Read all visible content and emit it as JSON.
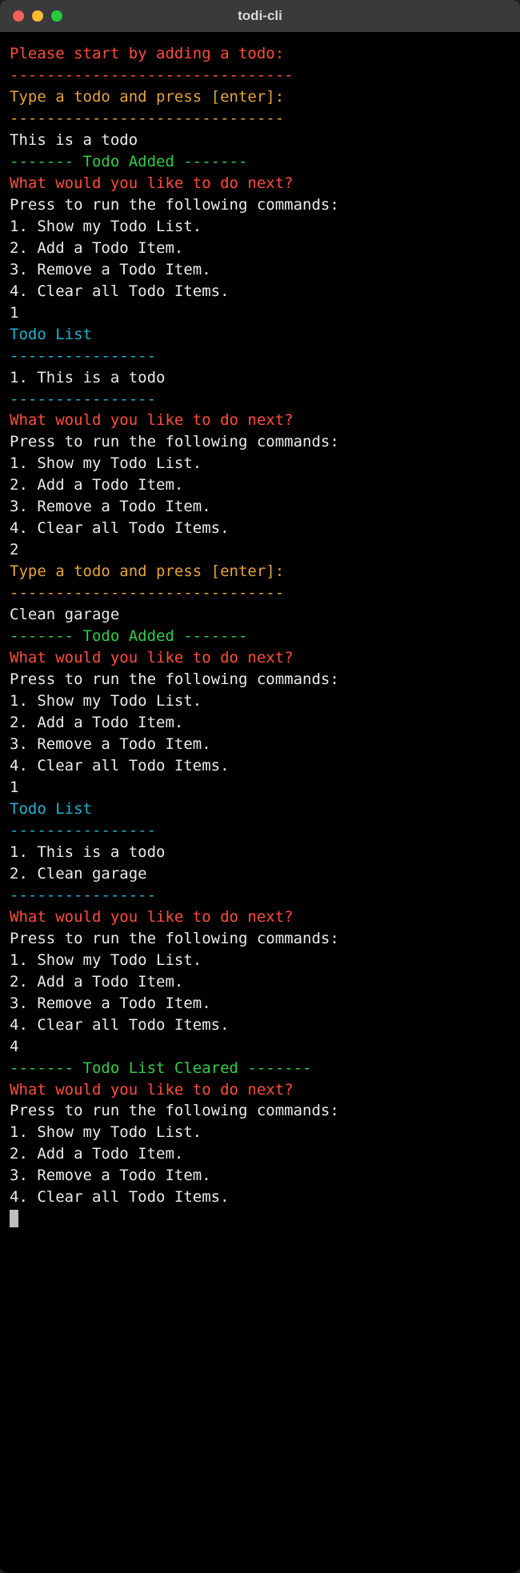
{
  "window": {
    "title": "todi-cli"
  },
  "colors": {
    "red": "#ff4c3d",
    "orange": "#e5a33b",
    "green": "#2fcc4a",
    "cyan": "#1fb3d4",
    "white": "#eaeaea"
  },
  "lines": [
    {
      "color": "red",
      "text": "Please start by adding a todo:"
    },
    {
      "color": "red",
      "text": "-------------------------------"
    },
    {
      "color": "orange",
      "text": "Type a todo and press [enter]:"
    },
    {
      "color": "orange",
      "text": "------------------------------"
    },
    {
      "color": "white",
      "text": "This is a todo"
    },
    {
      "color": "green",
      "text": "------- Todo Added -------"
    },
    {
      "color": "red",
      "text": "What would you like to do next?"
    },
    {
      "color": "white",
      "text": "Press to run the following commands:"
    },
    {
      "color": "white",
      "text": "1. Show my Todo List."
    },
    {
      "color": "white",
      "text": "2. Add a Todo Item."
    },
    {
      "color": "white",
      "text": "3. Remove a Todo Item."
    },
    {
      "color": "white",
      "text": "4. Clear all Todo Items."
    },
    {
      "color": "white",
      "text": "1"
    },
    {
      "color": "cyan",
      "text": "Todo List"
    },
    {
      "color": "cyan",
      "text": "----------------"
    },
    {
      "color": "white",
      "text": "1. This is a todo"
    },
    {
      "color": "cyan",
      "text": "----------------"
    },
    {
      "color": "red",
      "text": "What would you like to do next?"
    },
    {
      "color": "white",
      "text": "Press to run the following commands:"
    },
    {
      "color": "white",
      "text": "1. Show my Todo List."
    },
    {
      "color": "white",
      "text": "2. Add a Todo Item."
    },
    {
      "color": "white",
      "text": "3. Remove a Todo Item."
    },
    {
      "color": "white",
      "text": "4. Clear all Todo Items."
    },
    {
      "color": "white",
      "text": "2"
    },
    {
      "color": "orange",
      "text": "Type a todo and press [enter]:"
    },
    {
      "color": "orange",
      "text": "------------------------------"
    },
    {
      "color": "white",
      "text": "Clean garage"
    },
    {
      "color": "green",
      "text": "------- Todo Added -------"
    },
    {
      "color": "red",
      "text": "What would you like to do next?"
    },
    {
      "color": "white",
      "text": "Press to run the following commands:"
    },
    {
      "color": "white",
      "text": "1. Show my Todo List."
    },
    {
      "color": "white",
      "text": "2. Add a Todo Item."
    },
    {
      "color": "white",
      "text": "3. Remove a Todo Item."
    },
    {
      "color": "white",
      "text": "4. Clear all Todo Items."
    },
    {
      "color": "white",
      "text": "1"
    },
    {
      "color": "cyan",
      "text": "Todo List"
    },
    {
      "color": "cyan",
      "text": "----------------"
    },
    {
      "color": "white",
      "text": "1. This is a todo"
    },
    {
      "color": "white",
      "text": "2. Clean garage"
    },
    {
      "color": "cyan",
      "text": "----------------"
    },
    {
      "color": "red",
      "text": "What would you like to do next?"
    },
    {
      "color": "white",
      "text": "Press to run the following commands:"
    },
    {
      "color": "white",
      "text": "1. Show my Todo List."
    },
    {
      "color": "white",
      "text": "2. Add a Todo Item."
    },
    {
      "color": "white",
      "text": "3. Remove a Todo Item."
    },
    {
      "color": "white",
      "text": "4. Clear all Todo Items."
    },
    {
      "color": "white",
      "text": "4"
    },
    {
      "color": "green",
      "text": "------- Todo List Cleared -------"
    },
    {
      "color": "red",
      "text": "What would you like to do next?"
    },
    {
      "color": "white",
      "text": "Press to run the following commands:"
    },
    {
      "color": "white",
      "text": "1. Show my Todo List."
    },
    {
      "color": "white",
      "text": "2. Add a Todo Item."
    },
    {
      "color": "white",
      "text": "3. Remove a Todo Item."
    },
    {
      "color": "white",
      "text": "4. Clear all Todo Items."
    }
  ]
}
